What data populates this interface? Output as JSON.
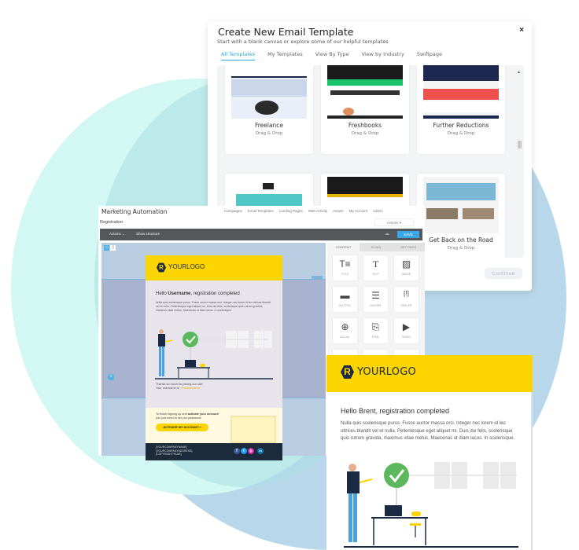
{
  "modal": {
    "title": "Create New Email Template",
    "subtitle": "Start with a blank canvas or explore some of our helpful templates",
    "close_icon": "×",
    "tabs": [
      {
        "label": "All Templates",
        "active": true
      },
      {
        "label": "My Templates",
        "active": false
      },
      {
        "label": "View By Type",
        "active": false
      },
      {
        "label": "View by Industry",
        "active": false
      },
      {
        "label": "Swiftpage",
        "active": false
      }
    ],
    "templates": [
      {
        "name": "Freelance",
        "type": "Drag & Drop"
      },
      {
        "name": "Freshbooks",
        "type": "Drag & Drop"
      },
      {
        "name": "Further Reductions",
        "type": "Drag & Drop"
      },
      {
        "name": "",
        "type": ""
      },
      {
        "name": "",
        "type": ""
      },
      {
        "name": "Get Back on the Road",
        "type": "Drag & Drop"
      }
    ],
    "continue_label": "Continue"
  },
  "builder": {
    "app_title": "Marketing Automation",
    "nav": [
      "Campaigns",
      "Email Templates",
      "Landing Pages",
      "Web Activity",
      "Assets",
      "My Account",
      "Admin"
    ],
    "breadcrumb": "Registration",
    "actions_dropdown": "Actions ▾",
    "toolbar": {
      "actions": "Actions ⌄",
      "show_structure": "Show structure",
      "save": "SAVE"
    },
    "panel_tabs": [
      "CONTENT",
      "ROWS",
      "SETTINGS"
    ],
    "tiles": [
      {
        "label": "TITLE",
        "icon": "T≡"
      },
      {
        "label": "TEXT",
        "icon": "T"
      },
      {
        "label": "IMAGE",
        "icon": "▨"
      },
      {
        "label": "BUTTON",
        "icon": "▬"
      },
      {
        "label": "DIVIDER",
        "icon": "☰"
      },
      {
        "label": "SPACER",
        "icon": "[!]"
      },
      {
        "label": "SOCIAL",
        "icon": "⊕"
      },
      {
        "label": "HTML",
        "icon": "⎘"
      },
      {
        "label": "VIDEO",
        "icon": "▶"
      }
    ],
    "email": {
      "logo": "YOURLOGO",
      "hello_prefix": "Hello ",
      "hello_name": "Username",
      "hello_suffix": ", registration completed",
      "body": "Nulla quis scelerisque purus. Fusce auctor massa orci. Integer nec lorem id leo ultrices blandit vel et nulla. Pellentesque eget aliquet mi. Duis dui felis, scelerisque quis rutrum gravida, maximus vitae metus. Maecenas ut diam lacus. In scelerisque.",
      "thanks_line": "Thanks so much for joining our site!",
      "username_label": "Your username is: ",
      "username_value": "TestUsername",
      "cta_text_1": "To finish signing up and ",
      "cta_text_bold": "activate your account",
      "cta_text_2": "you just need to set you password.",
      "cta_button": "ACTIVATE MY ACCOUNT »",
      "footer": [
        "{YOURCOMPANYNAME}",
        "{YOURCOMPANYADDRESS}",
        "{COPYRIGHTYEAR}"
      ],
      "social": [
        "f",
        "t",
        "◎",
        "in"
      ]
    }
  },
  "preview": {
    "logo": "YOURLOGO",
    "hello": "Hello Brent, registration completed",
    "body": "Nulla quis scelerisque purus. Fusce auctor massa orci. Integer nec lorem id leo ultrices blandit vel et nulla. Pellentesque eget aliquet mi. Duis dui felis, scelerisque quis rutrum gravida, maximus vitae metus. Maecenas ut diam lacus. In scelerisque."
  },
  "colors": {
    "accent": "#2aa6e0",
    "brand_yellow": "#fcd400",
    "navy": "#1b2a44",
    "check_green": "#5cb85c"
  }
}
